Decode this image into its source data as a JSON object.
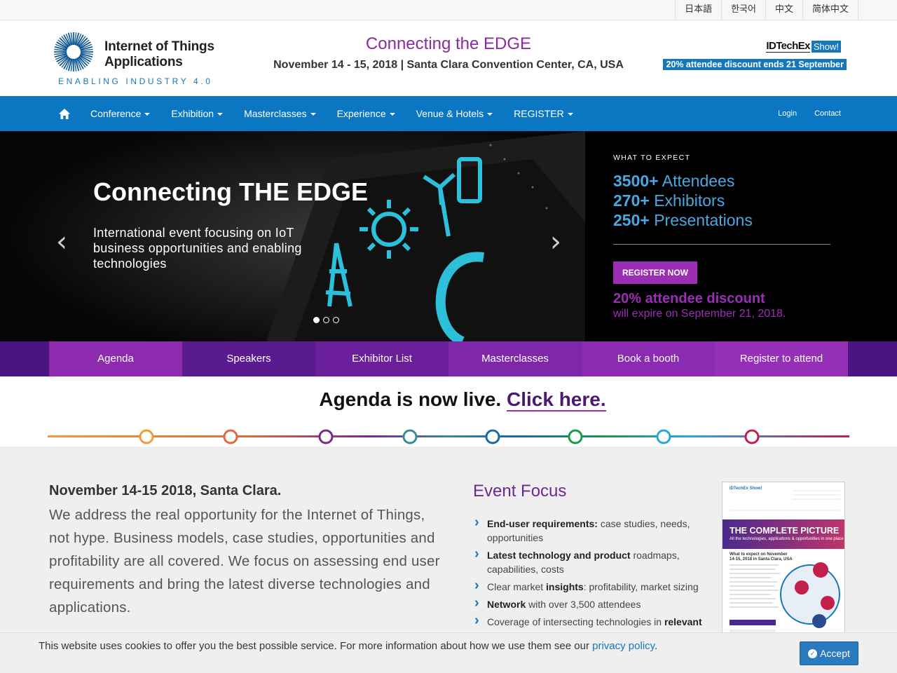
{
  "languages": [
    "日本語",
    "한국어",
    "中文",
    "简体中文"
  ],
  "logo": {
    "line1": "Internet of Things",
    "line2": "Applications",
    "tagline": "ENABLING INDUSTRY 4.0"
  },
  "event": {
    "title": "Connecting the EDGE",
    "subtitle": "November 14 - 15, 2018 | Santa Clara Convention Center, CA, USA"
  },
  "brand": {
    "name": "IDTechEx",
    "show": "Show!",
    "discount_strip": "20% attendee discount ends 21 September"
  },
  "nav": {
    "items": [
      {
        "label": "Conference"
      },
      {
        "label": "Exhibition"
      },
      {
        "label": "Masterclasses"
      },
      {
        "label": "Experience"
      },
      {
        "label": "Venue & Hotels"
      },
      {
        "label": "REGISTER"
      }
    ],
    "login": "Login",
    "contact": "Contact"
  },
  "hero": {
    "title": "Connecting THE EDGE",
    "text": "International event focusing on IoT business opportunities and enabling technologies",
    "prev": "‹",
    "next": "›",
    "slide_count": 3,
    "active_slide": 1
  },
  "expect": {
    "label": "WHAT TO EXPECT",
    "stats": [
      {
        "num": "3500+",
        "label": "Attendees"
      },
      {
        "num": "270+",
        "label": "Exhibitors"
      },
      {
        "num": "250+",
        "label": "Presentations"
      }
    ],
    "register_btn": "REGISTER NOW",
    "discount_big": "20% attendee discount",
    "discount_small": "will expire on September 21, 2018."
  },
  "tabs": [
    {
      "label": "Agenda",
      "color": "#8e2ab0"
    },
    {
      "label": "Speakers",
      "color": "#5a1a90"
    },
    {
      "label": "Exhibitor List",
      "color": "#6b1f9a"
    },
    {
      "label": "Masterclasses",
      "color": "#7e27a8"
    },
    {
      "label": "Book a booth",
      "color": "#8a2bb2"
    },
    {
      "label": "Register to attend",
      "color": "#962fb8"
    }
  ],
  "agenda_banner": {
    "text": "Agenda is now live.",
    "link": "Click here."
  },
  "intro": {
    "heading": "November 14-15 2018, Santa Clara.",
    "body": "We address the real opportunity for the Internet of Things, not hype. Business models, case studies, opportunities and profitability are all covered. We focus on assessing end user requirements and bring the latest diverse technologies and applications."
  },
  "focus": {
    "title": "Event Focus",
    "items": [
      {
        "bold": "End-user requirements:",
        "rest": " case studies, needs, opportunities"
      },
      {
        "bold": "Latest technology and product",
        "rest": " roadmaps, capabilities, costs"
      },
      {
        "pre": "Clear market ",
        "bold": "insights",
        "rest": ": profitability, market sizing"
      },
      {
        "bold": "Network",
        "rest": " with over 3,500 attendees"
      },
      {
        "pre": "Coverage of intersecting technologies in ",
        "bold": "relevant",
        "rest": ""
      }
    ]
  },
  "brochure": {
    "logo": "IDTechEx Show!",
    "headline": "THE COMPLETE PICTURE",
    "sub": "All the technologies, applications & opportunities in one place",
    "small": "What to expect on November 14-15, 2018 in Santa Clara, USA"
  },
  "cookie": {
    "text": "This website uses cookies to offer you the best possible service. For more information about how we use them see our ",
    "link": "privacy policy",
    "after": ".",
    "accept": "Accept"
  },
  "colors": {
    "nav_blue": "#0b77c2",
    "purple": "#9a2fb4",
    "stat_blue": "#4aa8e0"
  }
}
